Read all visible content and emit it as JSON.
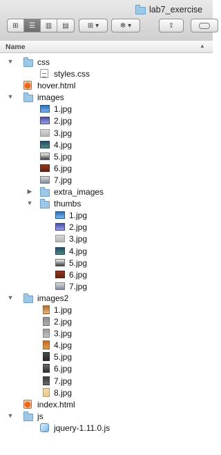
{
  "window": {
    "title": "lab7_exercise"
  },
  "toolbar": {
    "view_buttons": [
      {
        "name": "icon-view",
        "glyph": "⊞"
      },
      {
        "name": "list-view",
        "glyph": "☰"
      },
      {
        "name": "column-view",
        "glyph": "▥"
      },
      {
        "name": "coverflow-view",
        "glyph": "▤"
      }
    ],
    "arrange_glyph": "⊞ ▾",
    "action_glyph": "✻ ▾",
    "share_glyph": "⇪"
  },
  "columns": {
    "name_header": "Name",
    "sort_indicator": "▲"
  },
  "rows": [
    {
      "label": "css",
      "level": 0,
      "kind": "folder",
      "expanded": true
    },
    {
      "label": "styles.css",
      "level": 1,
      "kind": "css"
    },
    {
      "label": "hover.html",
      "level": 0,
      "kind": "html"
    },
    {
      "label": "images",
      "level": 0,
      "kind": "folder",
      "expanded": true
    },
    {
      "label": "1.jpg",
      "level": 1,
      "kind": "img",
      "thumb": "thumb-a"
    },
    {
      "label": "2.jpg",
      "level": 1,
      "kind": "img",
      "thumb": "thumb-b"
    },
    {
      "label": "3.jpg",
      "level": 1,
      "kind": "img",
      "thumb": "thumb-c"
    },
    {
      "label": "4.jpg",
      "level": 1,
      "kind": "img",
      "thumb": "thumb-d"
    },
    {
      "label": "5.jpg",
      "level": 1,
      "kind": "img",
      "thumb": "thumb-e"
    },
    {
      "label": "6.jpg",
      "level": 1,
      "kind": "img",
      "thumb": "thumb-f"
    },
    {
      "label": "7.jpg",
      "level": 1,
      "kind": "img",
      "thumb": "thumb-g"
    },
    {
      "label": "extra_images",
      "level": 1,
      "kind": "folder",
      "expanded": false
    },
    {
      "label": "thumbs",
      "level": 1,
      "kind": "folder",
      "expanded": true
    },
    {
      "label": "1.jpg",
      "level": 2,
      "kind": "img",
      "thumb": "thumb-a"
    },
    {
      "label": "2.jpg",
      "level": 2,
      "kind": "img",
      "thumb": "thumb-b"
    },
    {
      "label": "3.jpg",
      "level": 2,
      "kind": "img",
      "thumb": "thumb-c"
    },
    {
      "label": "4.jpg",
      "level": 2,
      "kind": "img",
      "thumb": "thumb-d"
    },
    {
      "label": "5.jpg",
      "level": 2,
      "kind": "img",
      "thumb": "thumb-e"
    },
    {
      "label": "6.jpg",
      "level": 2,
      "kind": "img",
      "thumb": "thumb-f"
    },
    {
      "label": "7.jpg",
      "level": 2,
      "kind": "img",
      "thumb": "thumb-g"
    },
    {
      "label": "images2",
      "level": 0,
      "kind": "folder",
      "expanded": true
    },
    {
      "label": "1.jpg",
      "level": 1,
      "kind": "strip",
      "thumb": "s1"
    },
    {
      "label": "2.jpg",
      "level": 1,
      "kind": "strip",
      "thumb": "s2"
    },
    {
      "label": "3.jpg",
      "level": 1,
      "kind": "strip",
      "thumb": "s3"
    },
    {
      "label": "4.jpg",
      "level": 1,
      "kind": "strip",
      "thumb": "s4"
    },
    {
      "label": "5.jpg",
      "level": 1,
      "kind": "strip",
      "thumb": "s5"
    },
    {
      "label": "6.jpg",
      "level": 1,
      "kind": "strip",
      "thumb": "s6"
    },
    {
      "label": "7.jpg",
      "level": 1,
      "kind": "strip",
      "thumb": "s7"
    },
    {
      "label": "8.jpg",
      "level": 1,
      "kind": "strip",
      "thumb": "s8"
    },
    {
      "label": "index.html",
      "level": 0,
      "kind": "html"
    },
    {
      "label": "js",
      "level": 0,
      "kind": "folder",
      "expanded": true
    },
    {
      "label": "jquery-1.11.0.js",
      "level": 1,
      "kind": "js"
    }
  ]
}
